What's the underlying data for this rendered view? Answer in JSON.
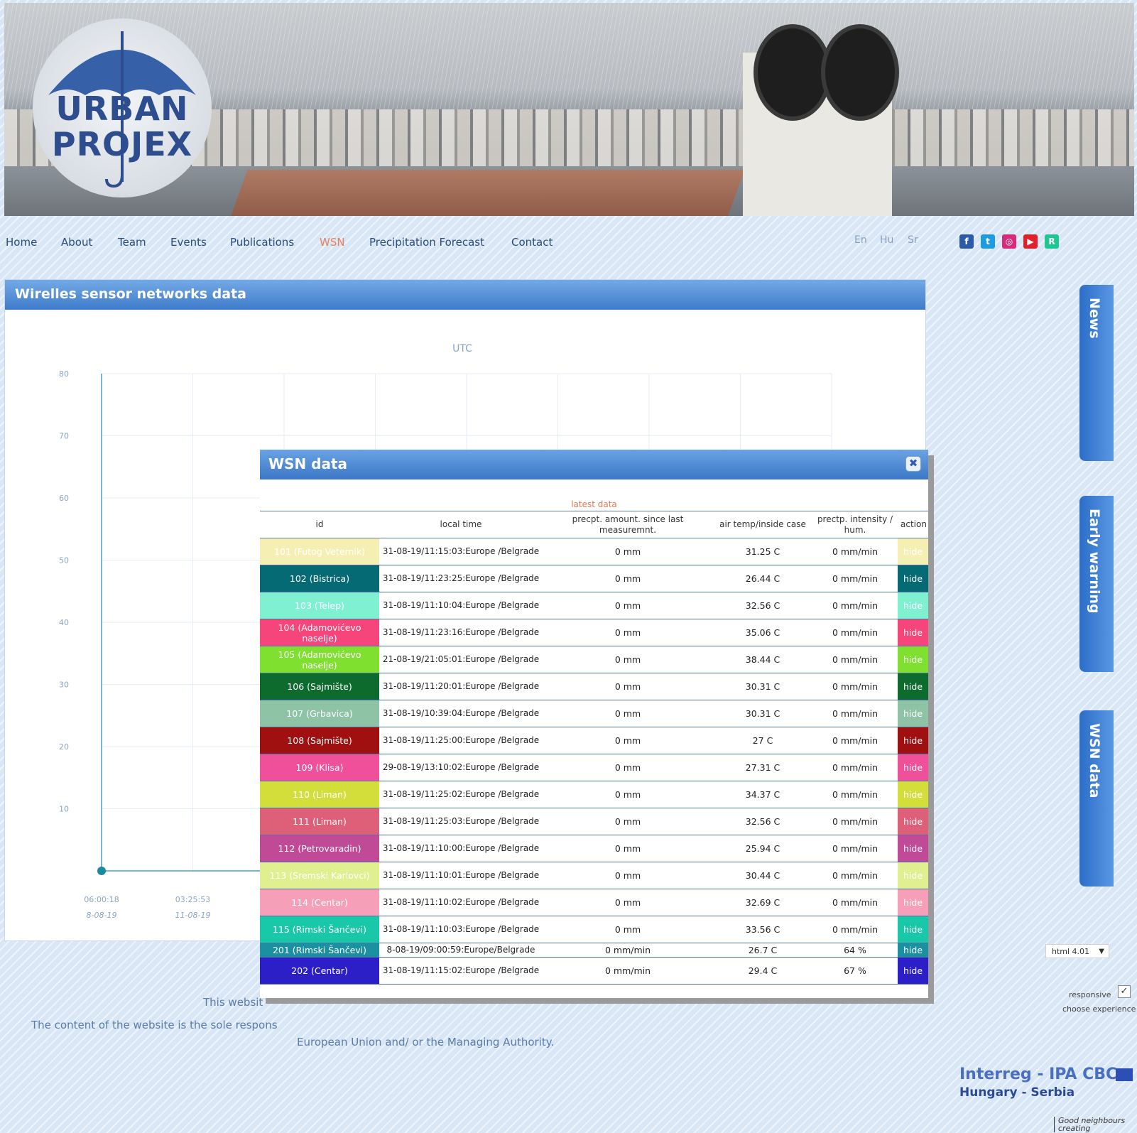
{
  "nav": {
    "items": [
      "Home",
      "About",
      "Team",
      "Events",
      "Publications",
      "WSN",
      "Precipitation Forecast",
      "Contact"
    ],
    "active": "WSN"
  },
  "languages": [
    "En",
    "Hu",
    "Sr"
  ],
  "social_icons": [
    "facebook-icon",
    "twitter-icon",
    "instagram-icon",
    "youtube-icon",
    "researchgate-icon"
  ],
  "logo": {
    "line1": "URBAN",
    "line2": "PROJEX"
  },
  "panel": {
    "title": "Wirelles sensor networks data"
  },
  "chart_data": {
    "type": "line",
    "title": "UTC",
    "y_ticks": [
      80,
      70,
      60,
      50,
      40,
      30,
      20,
      10
    ],
    "ylim": [
      0,
      80
    ],
    "x_ticks": [
      {
        "time": "06:00:18",
        "date": "8-08-19"
      },
      {
        "time": "03:25:53",
        "date": "11-08-19"
      }
    ],
    "series": [
      {
        "values": [
          0
        ]
      }
    ]
  },
  "side_tabs": [
    "News",
    "Early warning",
    "WSN data"
  ],
  "modal": {
    "title": "WSN data",
    "close_icon": "close-icon",
    "latest_label": "latest data",
    "headers": {
      "id": "id",
      "local_time": "local time",
      "precip_amount": "precpt. amount. since last measuremnt.",
      "air_temp": "air temp/inside case",
      "precip_intensity": "prectp. intensity / hum.",
      "action": "action"
    },
    "rows": [
      {
        "id": "101 (Futog Veternik)",
        "time": "31-08-19/11:15:03:Europe /Belgrade",
        "amount": "0 mm",
        "temp": "31.25 C",
        "intensity": "0 mm/min",
        "action": "hide",
        "color": "#f5efb4",
        "text": "#ffffff"
      },
      {
        "id": "102 (Bistrica)",
        "time": "31-08-19/11:23:25:Europe /Belgrade",
        "amount": "0 mm",
        "temp": "26.44 C",
        "intensity": "0 mm/min",
        "action": "hide",
        "color": "#066a75",
        "text": "#ffffff"
      },
      {
        "id": "103 (Telep)",
        "time": "31-08-19/11:10:04:Europe /Belgrade",
        "amount": "0 mm",
        "temp": "32.56 C",
        "intensity": "0 mm/min",
        "action": "hide",
        "color": "#7ff0d0",
        "text": "#ffffff"
      },
      {
        "id": "104 (Adamovićevo naselje)",
        "time": "31-08-19/11:23:16:Europe /Belgrade",
        "amount": "0 mm",
        "temp": "35.06 C",
        "intensity": "0 mm/min",
        "action": "hide",
        "color": "#f5457a",
        "text": "#ffffff"
      },
      {
        "id": "105 (Adamovićevo naselje)",
        "time": "21-08-19/21:05:01:Europe /Belgrade",
        "amount": "0 mm",
        "temp": "38.44 C",
        "intensity": "0 mm/min",
        "action": "hide",
        "color": "#7fe030",
        "text": "#ffffff"
      },
      {
        "id": "106 (Sajmište)",
        "time": "31-08-19/11:20:01:Europe /Belgrade",
        "amount": "0 mm",
        "temp": "30.31 C",
        "intensity": "0 mm/min",
        "action": "hide",
        "color": "#0e6b2e",
        "text": "#ffffff"
      },
      {
        "id": "107 (Grbavica)",
        "time": "31-08-19/10:39:04:Europe /Belgrade",
        "amount": "0 mm",
        "temp": "30.31 C",
        "intensity": "0 mm/min",
        "action": "hide",
        "color": "#8fc3a5",
        "text": "#ffffff"
      },
      {
        "id": "108 (Sajmište)",
        "time": "31-08-19/11:25:00:Europe /Belgrade",
        "amount": "0 mm",
        "temp": "27 C",
        "intensity": "0 mm/min",
        "action": "hide",
        "color": "#a01010",
        "text": "#ffffff"
      },
      {
        "id": "109 (Klisa)",
        "time": "29-08-19/13:10:02:Europe /Belgrade",
        "amount": "0 mm",
        "temp": "27.31 C",
        "intensity": "0 mm/min",
        "action": "hide",
        "color": "#f0509a",
        "text": "#ffffff"
      },
      {
        "id": "110 (Liman)",
        "time": "31-08-19/11:25:02:Europe /Belgrade",
        "amount": "0 mm",
        "temp": "34.37 C",
        "intensity": "0 mm/min",
        "action": "hide",
        "color": "#d4de3a",
        "text": "#ffffff"
      },
      {
        "id": "111 (Liman)",
        "time": "31-08-19/11:25:03:Europe /Belgrade",
        "amount": "0 mm",
        "temp": "32.56 C",
        "intensity": "0 mm/min",
        "action": "hide",
        "color": "#de6078",
        "text": "#ffffff"
      },
      {
        "id": "112 (Petrovaradin)",
        "time": "31-08-19/11:10:00:Europe /Belgrade",
        "amount": "0 mm",
        "temp": "25.94 C",
        "intensity": "0 mm/min",
        "action": "hide",
        "color": "#c04a96",
        "text": "#ffffff"
      },
      {
        "id": "113 (Sremski Karlovci)",
        "time": "31-08-19/11:10:01:Europe /Belgrade",
        "amount": "0 mm",
        "temp": "30.44 C",
        "intensity": "0 mm/min",
        "action": "hide",
        "color": "#e0f090",
        "text": "#ffffff"
      },
      {
        "id": "114 (Centar)",
        "time": "31-08-19/11:10:02:Europe /Belgrade",
        "amount": "0 mm",
        "temp": "32.69 C",
        "intensity": "0 mm/min",
        "action": "hide",
        "color": "#f5a0b8",
        "text": "#ffffff"
      },
      {
        "id": "115 (Rimski Šančevi)",
        "time": "31-08-19/11:10:03:Europe /Belgrade",
        "amount": "0 mm",
        "temp": "33.56 C",
        "intensity": "0 mm/min",
        "action": "hide",
        "color": "#18c8a8",
        "text": "#ffffff"
      },
      {
        "id": "201 (Rimski Šančevi)",
        "time": "8-08-19/09:00:59:Europe/Belgrade",
        "amount": "0 mm/min",
        "temp": "26.7 C",
        "intensity": "64 %",
        "action": "hide",
        "color": "#1a90a0",
        "text": "#ffffff",
        "short": true
      },
      {
        "id": "202 (Centar)",
        "time": "31-08-19/11:15:02:Europe /Belgrade",
        "amount": "0 mm/min",
        "temp": "29.4 C",
        "intensity": "67 %",
        "action": "hide",
        "color": "#2c1fc8",
        "text": "#ffffff"
      }
    ]
  },
  "footer": {
    "line1_prefix": "This websit",
    "line2_prefix": "The content of the website is the sole respons",
    "line3": "European Union and/ or the Managing Authority."
  },
  "html_select": {
    "value": "html 4.01"
  },
  "responsive": {
    "label": "responsive",
    "checked": true,
    "choose": "choose experience"
  },
  "interreg": {
    "line1": "Interreg - IPA CBC",
    "line2": "Hungary - Serbia",
    "tag": "Good neighbours creating"
  }
}
